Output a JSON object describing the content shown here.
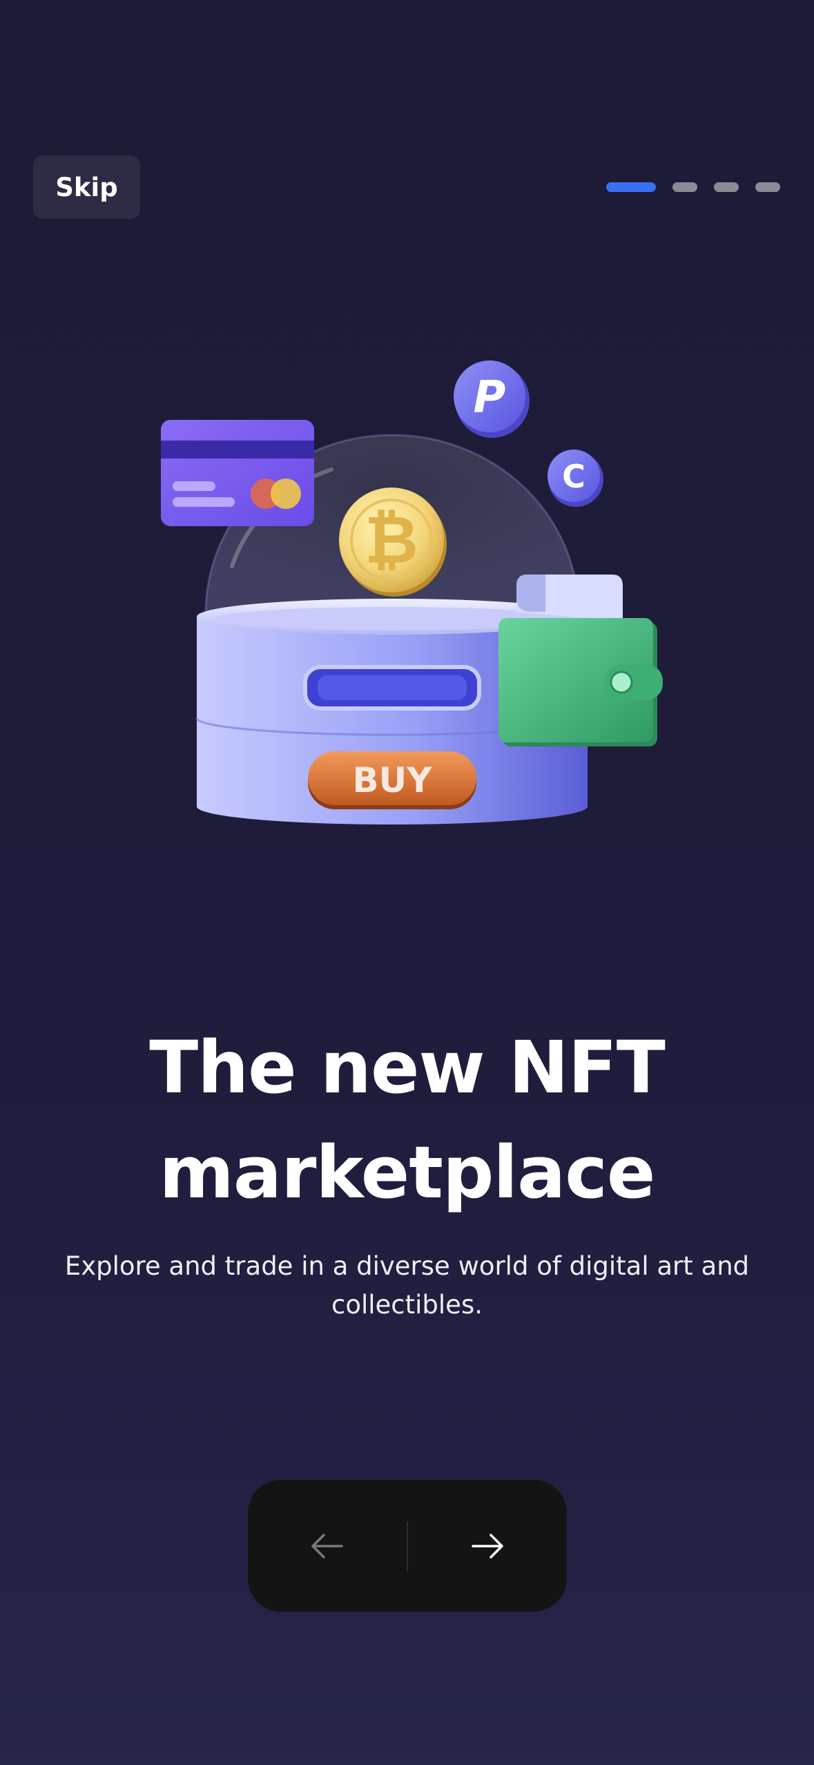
{
  "header": {
    "skip_label": "Skip",
    "pagination": {
      "total": 4,
      "current": 1
    }
  },
  "illustration": {
    "buy_label": "BUY",
    "icons": [
      "credit-card-icon",
      "paypal-coin-icon",
      "coin-c-icon",
      "bitcoin-coin-icon",
      "wallet-icon",
      "store-dome-icon"
    ]
  },
  "content": {
    "title_line1": "The new NFT",
    "title_line2": "marketplace",
    "subtitle": "Explore and trade in a diverse world of digital art and collectibles."
  },
  "navigation": {
    "prev_icon": "arrow-left-icon",
    "next_icon": "arrow-right-icon"
  },
  "colors": {
    "background": "#1d1b36",
    "accent": "#3a6ff5",
    "dot_inactive": "#8b8b96",
    "skip_bg": "#2d2c44",
    "nav_bg": "#141414"
  }
}
